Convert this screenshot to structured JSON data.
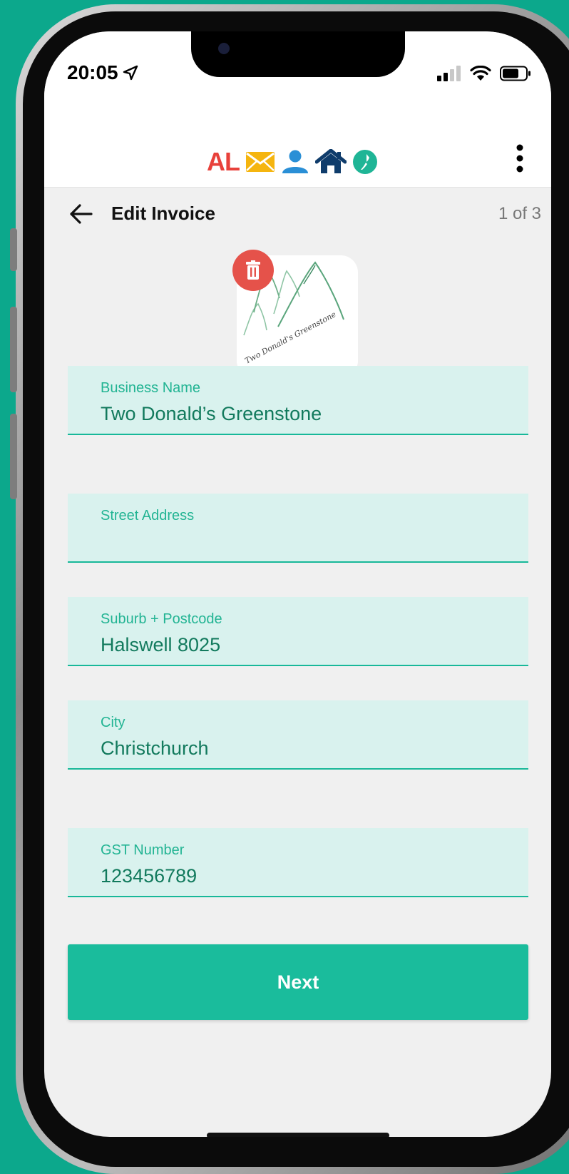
{
  "status_bar": {
    "time": "20:05"
  },
  "app_bar": {
    "logo_text": "AL",
    "icons": [
      "envelope-icon",
      "person-icon",
      "home-icon",
      "nz-map-icon"
    ],
    "menu_icon": "more-vertical-icon"
  },
  "header": {
    "back_icon": "arrow-left-icon",
    "title": "Edit Invoice",
    "page_counter": "1 of 3"
  },
  "business_logo": {
    "signature_text": "Two Donald's Greenstone",
    "delete_icon": "trash-icon"
  },
  "form": {
    "business_name": {
      "label": "Business Name",
      "value": "Two Donald’s Greenstone"
    },
    "street_address": {
      "label": "Street Address",
      "value": ""
    },
    "suburb_postcode": {
      "label": "Suburb + Postcode",
      "value": "Halswell 8025"
    },
    "city": {
      "label": "City",
      "value": "Christchurch"
    },
    "gst_number": {
      "label": "GST Number",
      "value": "123456789"
    }
  },
  "actions": {
    "next_label": "Next"
  },
  "colors": {
    "background": "#0ca88c",
    "accent": "#1abc9c",
    "field_bg": "#d9f2ee",
    "field_label": "#22b493",
    "field_value": "#127a5d",
    "delete": "#e5524a",
    "logo_red": "#e8413b",
    "envelope": "#f5b50f",
    "person": "#2a8fd6",
    "home": "#0f3c6b"
  }
}
